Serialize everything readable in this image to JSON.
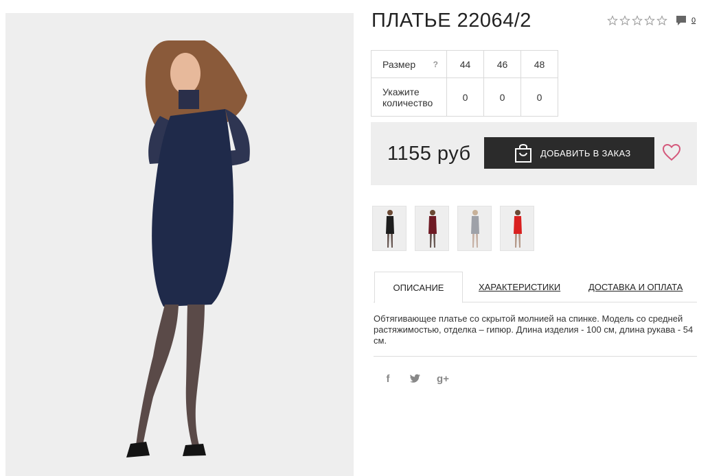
{
  "product": {
    "title": "ПЛАТЬЕ 22064/2",
    "rating_stars": 5,
    "comments_count": "0",
    "price": "1155 руб",
    "add_to_order_label": "ДОБАВИТЬ В ЗАКАЗ",
    "description": "Обтягивающее платье со скрытой молнией на спинке. Модель со средней растяжимостью, отделка – гипюр. Длина изделия - 100 см, длина рукава - 54 см."
  },
  "size_table": {
    "size_label": "Размер",
    "help_mark": "?",
    "qty_label_line1": "Укажите",
    "qty_label_line2": "количество",
    "sizes": [
      "44",
      "46",
      "48"
    ],
    "quantities": [
      "0",
      "0",
      "0"
    ]
  },
  "thumbnails": [
    {
      "dress_color": "#1d1d1d"
    },
    {
      "dress_color": "#6e1a24"
    },
    {
      "dress_color": "#9ea1a8"
    },
    {
      "dress_color": "#d9201f"
    }
  ],
  "tabs": [
    {
      "label": "ОПИСАНИЕ"
    },
    {
      "label": "ХАРАКТЕРИСТИКИ"
    },
    {
      "label": "ДОСТАВКА И ОПЛАТА"
    }
  ],
  "social": {
    "facebook": "f",
    "twitter": "twitter-icon",
    "google": "g+"
  },
  "colors": {
    "accent": "#d4577a",
    "button": "#2b2b2b",
    "dress_main": "#1f2a4a",
    "panel_bg": "#eeeeee"
  }
}
